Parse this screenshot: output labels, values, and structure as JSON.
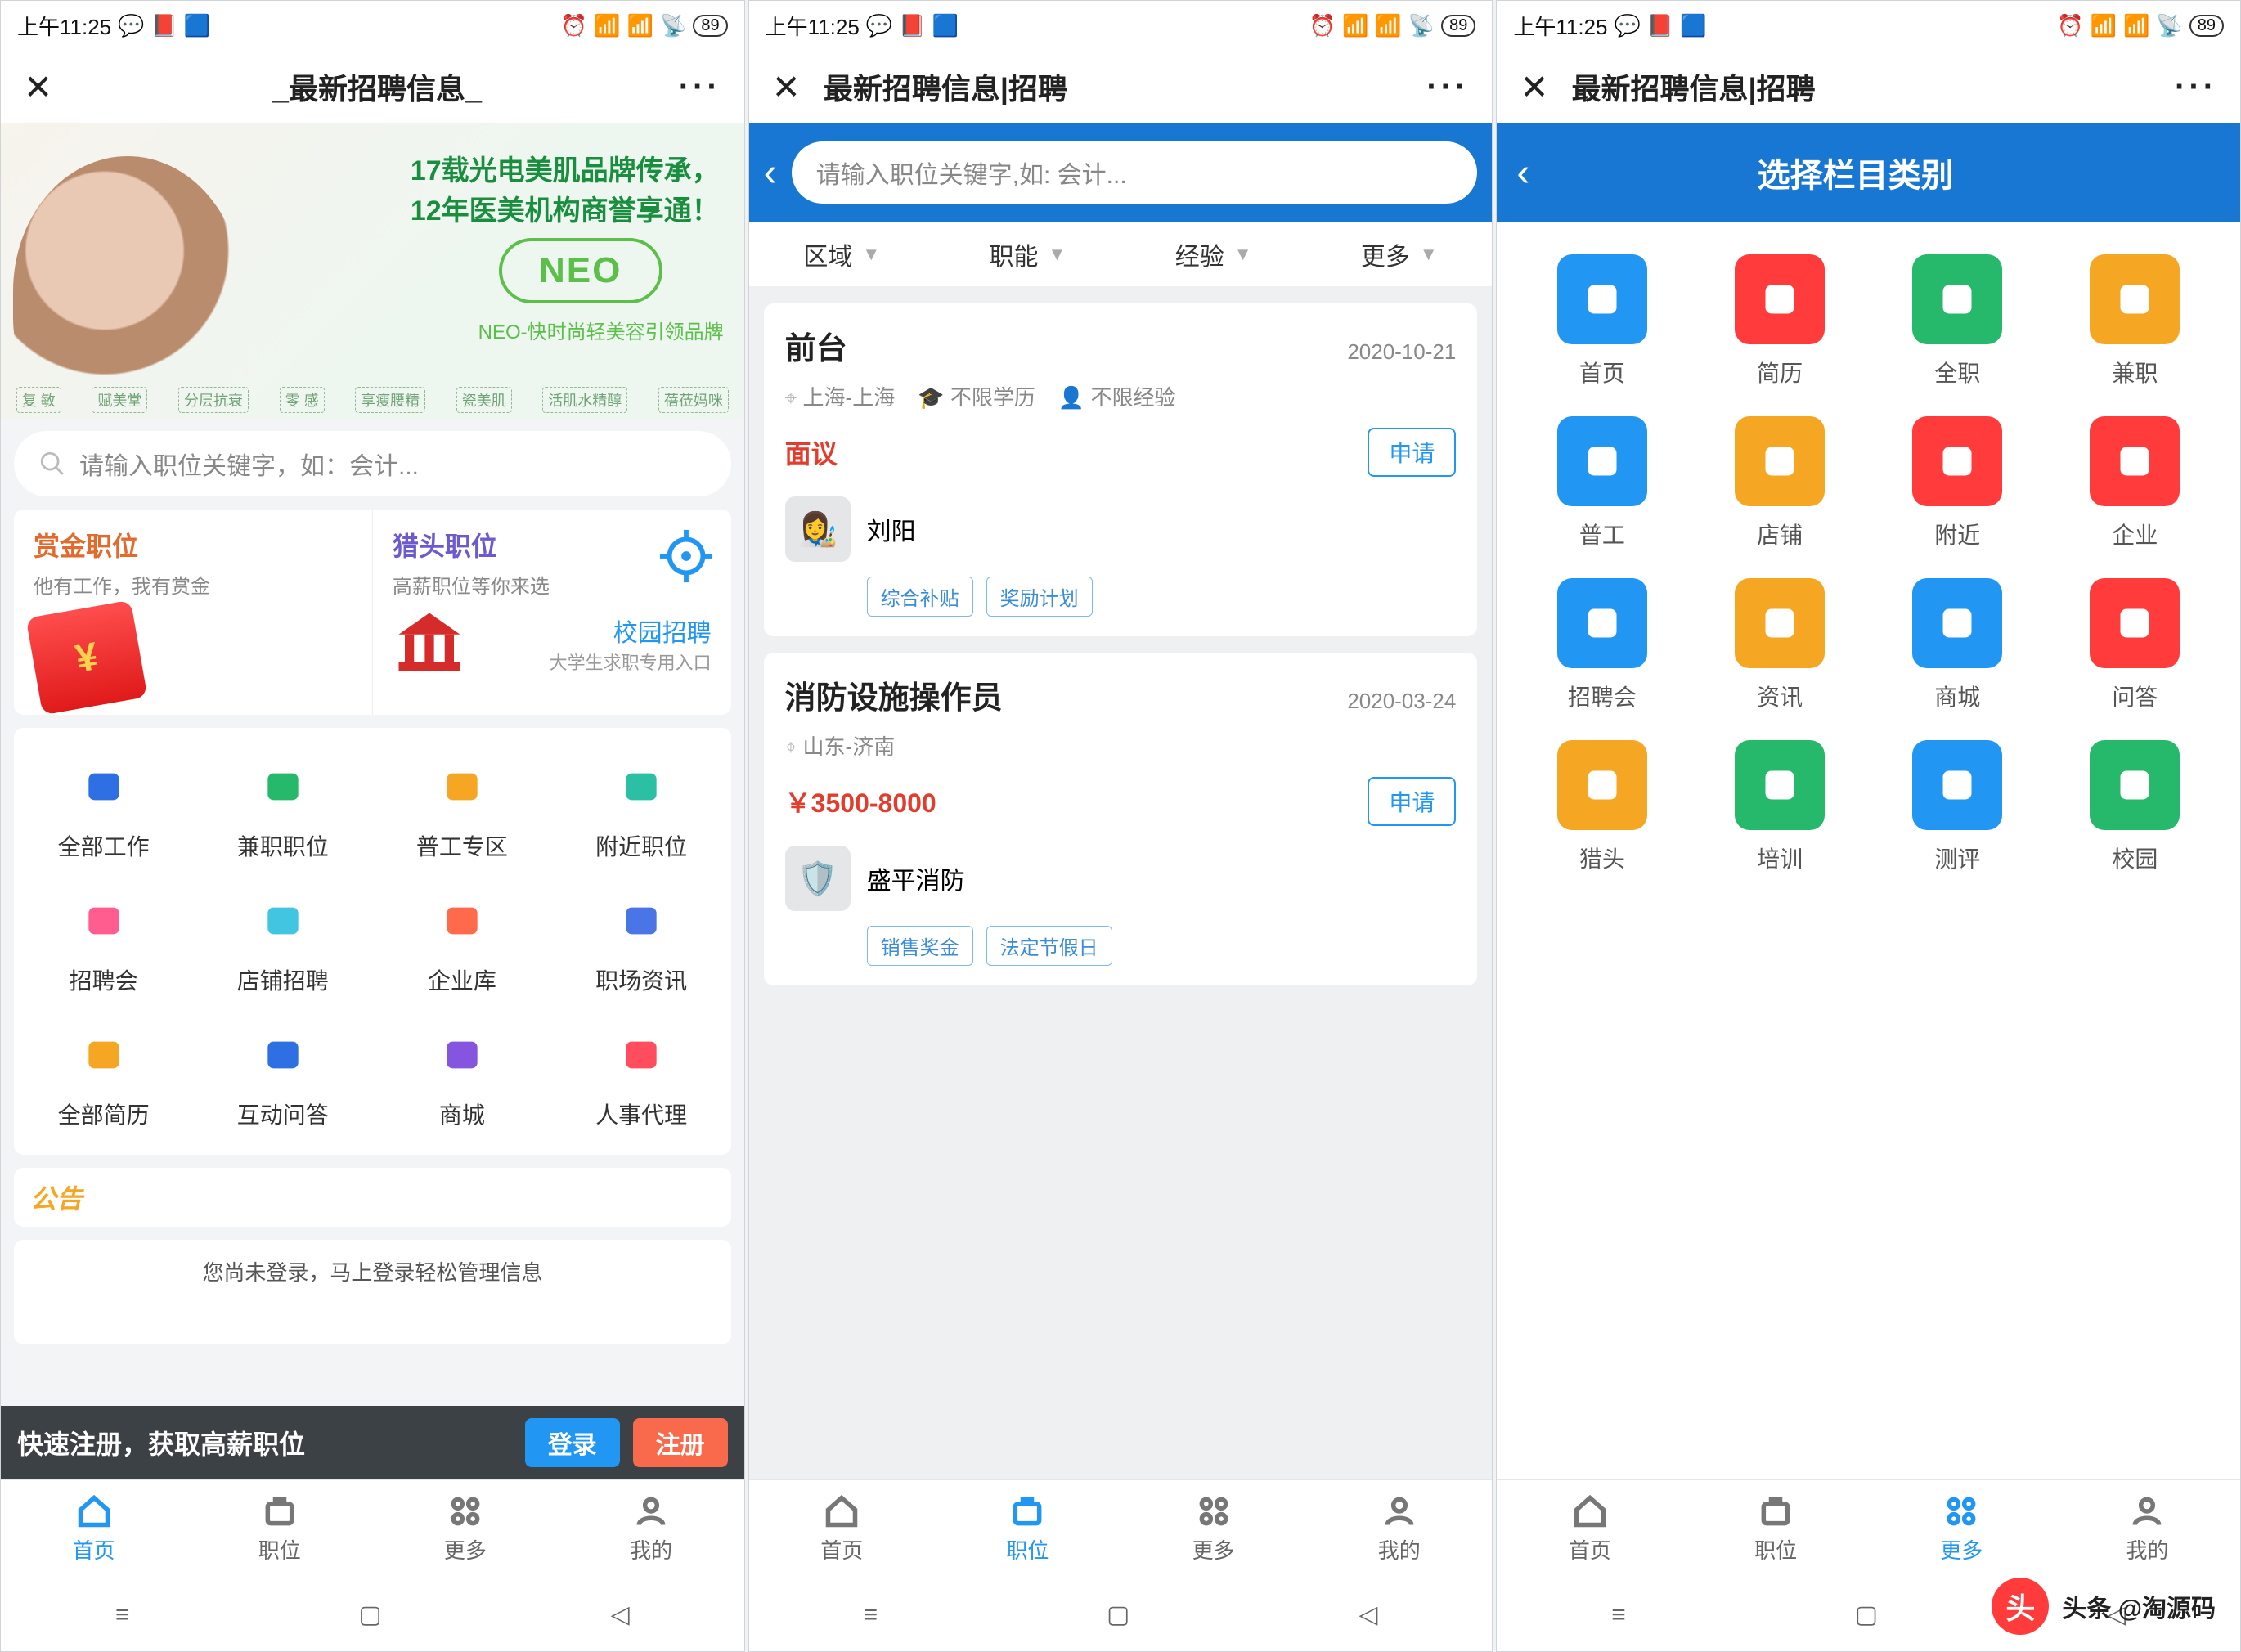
{
  "status": {
    "time": "上午11:25",
    "battery": "89"
  },
  "titles": {
    "p1": "_最新招聘信息_",
    "p2": "最新招聘信息|招聘",
    "p3": "最新招聘信息|招聘"
  },
  "search_placeholder": "请输入职位关键字，如：会计...",
  "search_placeholder2": "请输入职位关键字,如: 会计...",
  "banner": {
    "l1": "17载光电美肌品牌传承，",
    "l2": "12年医美机构商誉享通！",
    "logo": "NEO",
    "sub": "NEO-快时尚轻美容引领品牌",
    "boxes": [
      "复 敏",
      "赋美堂",
      "分层抗衰",
      "零 感",
      "享瘦腰精",
      "瓷美肌",
      "活肌水精醇",
      "蓓莅妈咪"
    ]
  },
  "promo": {
    "a_title": "赏金职位",
    "a_sub": "他有工作，我有赏金",
    "b_title": "猎头职位",
    "b_sub": "高薪职位等你来选",
    "campus_title": "校园招聘",
    "campus_sub": "大学生求职专用入口"
  },
  "home_icons": [
    {
      "l": "全部工作",
      "c": "#2f6fe4"
    },
    {
      "l": "兼职职位",
      "c": "#27b96b"
    },
    {
      "l": "普工专区",
      "c": "#f5a623"
    },
    {
      "l": "附近职位",
      "c": "#2bbfa3"
    },
    {
      "l": "招聘会",
      "c": "#ff5d8f"
    },
    {
      "l": "店铺招聘",
      "c": "#42c5e0"
    },
    {
      "l": "企业库",
      "c": "#ff6a4d"
    },
    {
      "l": "职场资讯",
      "c": "#4a75e6"
    },
    {
      "l": "全部简历",
      "c": "#f5a623"
    },
    {
      "l": "互动问答",
      "c": "#2f6fe4"
    },
    {
      "l": "商城",
      "c": "#8655e0"
    },
    {
      "l": "人事代理",
      "c": "#ff4d5e"
    }
  ],
  "announce": "公告",
  "logincard": "您尚未登录，马上登录轻松管理信息",
  "bottombar": {
    "txt": "快速注册，获取高薪职位",
    "login": "登录",
    "reg": "注册"
  },
  "tabs": [
    "首页",
    "职位",
    "更多",
    "我的"
  ],
  "filter": [
    "区域",
    "职能",
    "经验",
    "更多"
  ],
  "jobs": [
    {
      "title": "前台",
      "date": "2020-10-21",
      "loc": "上海-上海",
      "edu": "不限学历",
      "exp": "不限经验",
      "salary": "面议",
      "apply": "申请",
      "company": "刘阳",
      "avatar": "👩‍🎨",
      "tags": [
        "综合补贴",
        "奖励计划"
      ]
    },
    {
      "title": "消防设施操作员",
      "date": "2020-03-24",
      "loc": "山东-济南",
      "edu": "",
      "exp": "",
      "salary": "￥3500-8000",
      "apply": "申请",
      "company": "盛平消防",
      "avatar": "🛡️",
      "tags": [
        "销售奖金",
        "法定节假日"
      ]
    }
  ],
  "cat_header": "选择栏目类别",
  "categories": [
    {
      "l": "首页",
      "c": "#2196f3"
    },
    {
      "l": "简历",
      "c": "#ff3b3b"
    },
    {
      "l": "全职",
      "c": "#27b96b"
    },
    {
      "l": "兼职",
      "c": "#f5a623"
    },
    {
      "l": "普工",
      "c": "#2196f3"
    },
    {
      "l": "店铺",
      "c": "#f5a623"
    },
    {
      "l": "附近",
      "c": "#ff3b3b"
    },
    {
      "l": "企业",
      "c": "#ff3b3b"
    },
    {
      "l": "招聘会",
      "c": "#2196f3"
    },
    {
      "l": "资讯",
      "c": "#f5a623"
    },
    {
      "l": "商城",
      "c": "#2196f3"
    },
    {
      "l": "问答",
      "c": "#ff3b3b"
    },
    {
      "l": "猎头",
      "c": "#f5a623"
    },
    {
      "l": "培训",
      "c": "#27b96b"
    },
    {
      "l": "测评",
      "c": "#2196f3"
    },
    {
      "l": "校园",
      "c": "#27b96b"
    }
  ],
  "watermark": "头条 @淘源码"
}
